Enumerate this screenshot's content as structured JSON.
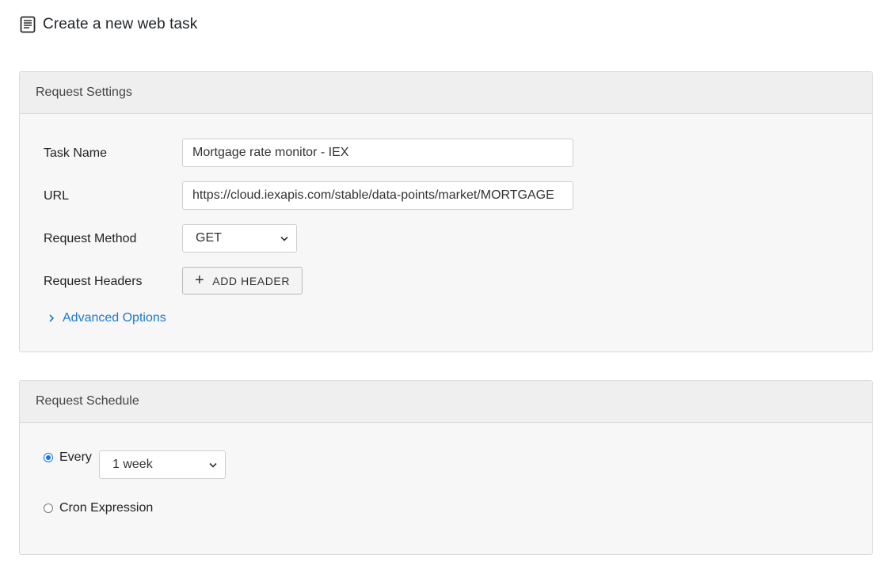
{
  "page": {
    "title": "Create a new web task"
  },
  "request_settings": {
    "header": "Request Settings",
    "task_name_label": "Task Name",
    "task_name_value": "Mortgage rate monitor - IEX",
    "url_label": "URL",
    "url_value": "https://cloud.iexapis.com/stable/data-points/market/MORTGAGE",
    "method_label": "Request Method",
    "method_value": "GET",
    "headers_label": "Request Headers",
    "add_header_label": "ADD HEADER",
    "advanced_options_label": "Advanced Options"
  },
  "request_schedule": {
    "header": "Request Schedule",
    "every_label": "Every",
    "every_value": "1 week",
    "every_selected": true,
    "cron_label": "Cron Expression",
    "cron_selected": false
  },
  "colors": {
    "link": "#1f78d1",
    "radio_accent": "#1a73e8"
  },
  "icons": {
    "title": "document-icon",
    "advanced": "chevron-right-icon",
    "select": "chevron-down-icon",
    "add": "plus-icon"
  }
}
